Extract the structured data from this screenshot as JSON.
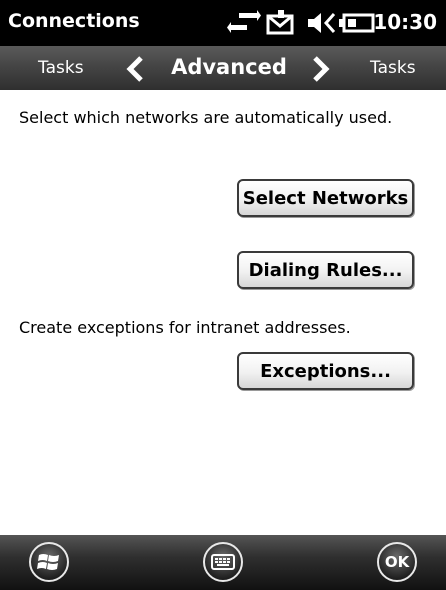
{
  "status_bar": {
    "app_title": "Connections",
    "time": "10:30",
    "icons": [
      "connectivity-icon",
      "message-icon",
      "volume-muted-icon",
      "battery-icon"
    ]
  },
  "tabs": {
    "previous": "Tasks",
    "current": "Advanced",
    "next": "Tasks"
  },
  "content": {
    "networks_text": "Select which networks are automatically used.",
    "select_networks_button": "Select Networks",
    "dialing_rules_button": "Dialing Rules...",
    "exceptions_text": "Create exceptions for intranet addresses.",
    "exceptions_button": "Exceptions..."
  },
  "softkeys": {
    "start_icon": "windows-start-icon",
    "keyboard_icon": "keyboard-icon",
    "ok_label": "OK"
  }
}
